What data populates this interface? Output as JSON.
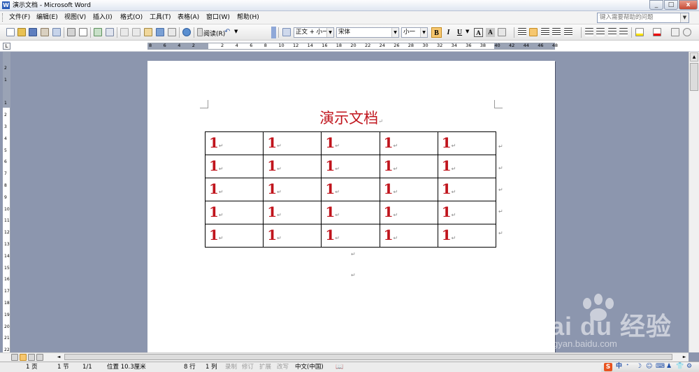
{
  "window": {
    "title": "演示文档 - Microsoft Word",
    "app_icon": "word-icon",
    "controls": [
      "_",
      "□",
      "x"
    ]
  },
  "menu": {
    "items": [
      "文件(F)",
      "编辑(E)",
      "视图(V)",
      "插入(I)",
      "格式(O)",
      "工具(T)",
      "表格(A)",
      "窗口(W)",
      "帮助(H)"
    ],
    "help_placeholder": "键入需要帮助的问题"
  },
  "toolbar": {
    "read_label": "阅读(R)",
    "style_value": "正文 + 小一",
    "font_value": "宋体",
    "size_value": "小一",
    "format_buttons": [
      "B",
      "I",
      "U",
      "A",
      "A"
    ]
  },
  "ruler": {
    "h_ticks": [
      "8",
      "6",
      "4",
      "2",
      "",
      "2",
      "4",
      "6",
      "8",
      "10",
      "12",
      "14",
      "16",
      "18",
      "20",
      "22",
      "24",
      "26",
      "28",
      "30",
      "32",
      "34",
      "36",
      "38",
      "40",
      "42",
      "44",
      "46",
      "48"
    ],
    "v_ticks": [
      "2",
      "1",
      "",
      "1",
      "2",
      "3",
      "4",
      "5",
      "6",
      "7",
      "8",
      "9",
      "10",
      "11",
      "12",
      "13",
      "14",
      "15",
      "16",
      "17",
      "18",
      "19",
      "20",
      "21",
      "22"
    ]
  },
  "document": {
    "title": "演示文档",
    "para_mark": "↵",
    "table": {
      "rows": [
        [
          "1",
          "1",
          "1",
          "1",
          "1"
        ],
        [
          "1",
          "1",
          "1",
          "1",
          "1"
        ],
        [
          "1",
          "1",
          "1",
          "1",
          "1"
        ],
        [
          "1",
          "1",
          "1",
          "1",
          "1"
        ],
        [
          "1",
          "1",
          "1",
          "1",
          "1"
        ]
      ]
    }
  },
  "status": {
    "page": "1 页",
    "section": "1 节",
    "page_of": "1/1",
    "position": "位置 10.3厘米",
    "line": "8 行",
    "column": "1 列",
    "rec": "录制",
    "trk": "修订",
    "ext": "扩展",
    "ovr": "改写",
    "language": "中文(中国)"
  },
  "watermark": {
    "logo": "Bai du 经验",
    "url": "jingyan.baidu.com"
  },
  "colors": {
    "accent_red": "#c0141c",
    "workspace": "#8c96ae"
  }
}
